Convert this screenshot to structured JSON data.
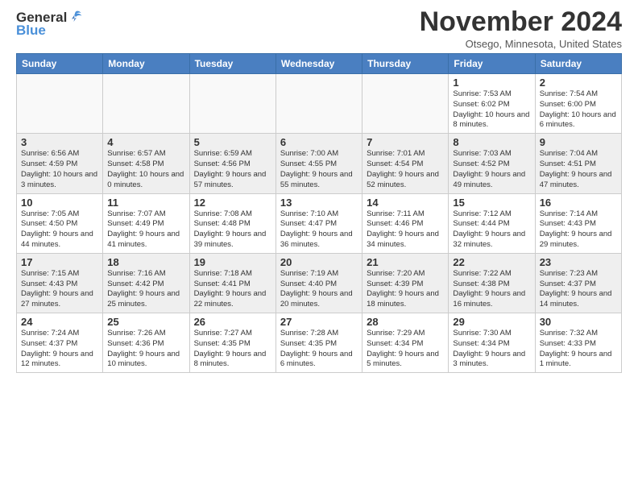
{
  "header": {
    "logo": {
      "general": "General",
      "blue": "Blue"
    },
    "title": "November 2024",
    "location": "Otsego, Minnesota, United States"
  },
  "days_of_week": [
    "Sunday",
    "Monday",
    "Tuesday",
    "Wednesday",
    "Thursday",
    "Friday",
    "Saturday"
  ],
  "weeks": [
    {
      "days": [
        {
          "num": "",
          "info": ""
        },
        {
          "num": "",
          "info": ""
        },
        {
          "num": "",
          "info": ""
        },
        {
          "num": "",
          "info": ""
        },
        {
          "num": "",
          "info": ""
        },
        {
          "num": "1",
          "info": "Sunrise: 7:53 AM\nSunset: 6:02 PM\nDaylight: 10 hours and 8 minutes."
        },
        {
          "num": "2",
          "info": "Sunrise: 7:54 AM\nSunset: 6:00 PM\nDaylight: 10 hours and 6 minutes."
        }
      ]
    },
    {
      "days": [
        {
          "num": "3",
          "info": "Sunrise: 6:56 AM\nSunset: 4:59 PM\nDaylight: 10 hours and 3 minutes."
        },
        {
          "num": "4",
          "info": "Sunrise: 6:57 AM\nSunset: 4:58 PM\nDaylight: 10 hours and 0 minutes."
        },
        {
          "num": "5",
          "info": "Sunrise: 6:59 AM\nSunset: 4:56 PM\nDaylight: 9 hours and 57 minutes."
        },
        {
          "num": "6",
          "info": "Sunrise: 7:00 AM\nSunset: 4:55 PM\nDaylight: 9 hours and 55 minutes."
        },
        {
          "num": "7",
          "info": "Sunrise: 7:01 AM\nSunset: 4:54 PM\nDaylight: 9 hours and 52 minutes."
        },
        {
          "num": "8",
          "info": "Sunrise: 7:03 AM\nSunset: 4:52 PM\nDaylight: 9 hours and 49 minutes."
        },
        {
          "num": "9",
          "info": "Sunrise: 7:04 AM\nSunset: 4:51 PM\nDaylight: 9 hours and 47 minutes."
        }
      ]
    },
    {
      "days": [
        {
          "num": "10",
          "info": "Sunrise: 7:05 AM\nSunset: 4:50 PM\nDaylight: 9 hours and 44 minutes."
        },
        {
          "num": "11",
          "info": "Sunrise: 7:07 AM\nSunset: 4:49 PM\nDaylight: 9 hours and 41 minutes."
        },
        {
          "num": "12",
          "info": "Sunrise: 7:08 AM\nSunset: 4:48 PM\nDaylight: 9 hours and 39 minutes."
        },
        {
          "num": "13",
          "info": "Sunrise: 7:10 AM\nSunset: 4:47 PM\nDaylight: 9 hours and 36 minutes."
        },
        {
          "num": "14",
          "info": "Sunrise: 7:11 AM\nSunset: 4:46 PM\nDaylight: 9 hours and 34 minutes."
        },
        {
          "num": "15",
          "info": "Sunrise: 7:12 AM\nSunset: 4:44 PM\nDaylight: 9 hours and 32 minutes."
        },
        {
          "num": "16",
          "info": "Sunrise: 7:14 AM\nSunset: 4:43 PM\nDaylight: 9 hours and 29 minutes."
        }
      ]
    },
    {
      "days": [
        {
          "num": "17",
          "info": "Sunrise: 7:15 AM\nSunset: 4:43 PM\nDaylight: 9 hours and 27 minutes."
        },
        {
          "num": "18",
          "info": "Sunrise: 7:16 AM\nSunset: 4:42 PM\nDaylight: 9 hours and 25 minutes."
        },
        {
          "num": "19",
          "info": "Sunrise: 7:18 AM\nSunset: 4:41 PM\nDaylight: 9 hours and 22 minutes."
        },
        {
          "num": "20",
          "info": "Sunrise: 7:19 AM\nSunset: 4:40 PM\nDaylight: 9 hours and 20 minutes."
        },
        {
          "num": "21",
          "info": "Sunrise: 7:20 AM\nSunset: 4:39 PM\nDaylight: 9 hours and 18 minutes."
        },
        {
          "num": "22",
          "info": "Sunrise: 7:22 AM\nSunset: 4:38 PM\nDaylight: 9 hours and 16 minutes."
        },
        {
          "num": "23",
          "info": "Sunrise: 7:23 AM\nSunset: 4:37 PM\nDaylight: 9 hours and 14 minutes."
        }
      ]
    },
    {
      "days": [
        {
          "num": "24",
          "info": "Sunrise: 7:24 AM\nSunset: 4:37 PM\nDaylight: 9 hours and 12 minutes."
        },
        {
          "num": "25",
          "info": "Sunrise: 7:26 AM\nSunset: 4:36 PM\nDaylight: 9 hours and 10 minutes."
        },
        {
          "num": "26",
          "info": "Sunrise: 7:27 AM\nSunset: 4:35 PM\nDaylight: 9 hours and 8 minutes."
        },
        {
          "num": "27",
          "info": "Sunrise: 7:28 AM\nSunset: 4:35 PM\nDaylight: 9 hours and 6 minutes."
        },
        {
          "num": "28",
          "info": "Sunrise: 7:29 AM\nSunset: 4:34 PM\nDaylight: 9 hours and 5 minutes."
        },
        {
          "num": "29",
          "info": "Sunrise: 7:30 AM\nSunset: 4:34 PM\nDaylight: 9 hours and 3 minutes."
        },
        {
          "num": "30",
          "info": "Sunrise: 7:32 AM\nSunset: 4:33 PM\nDaylight: 9 hours and 1 minute."
        }
      ]
    }
  ]
}
